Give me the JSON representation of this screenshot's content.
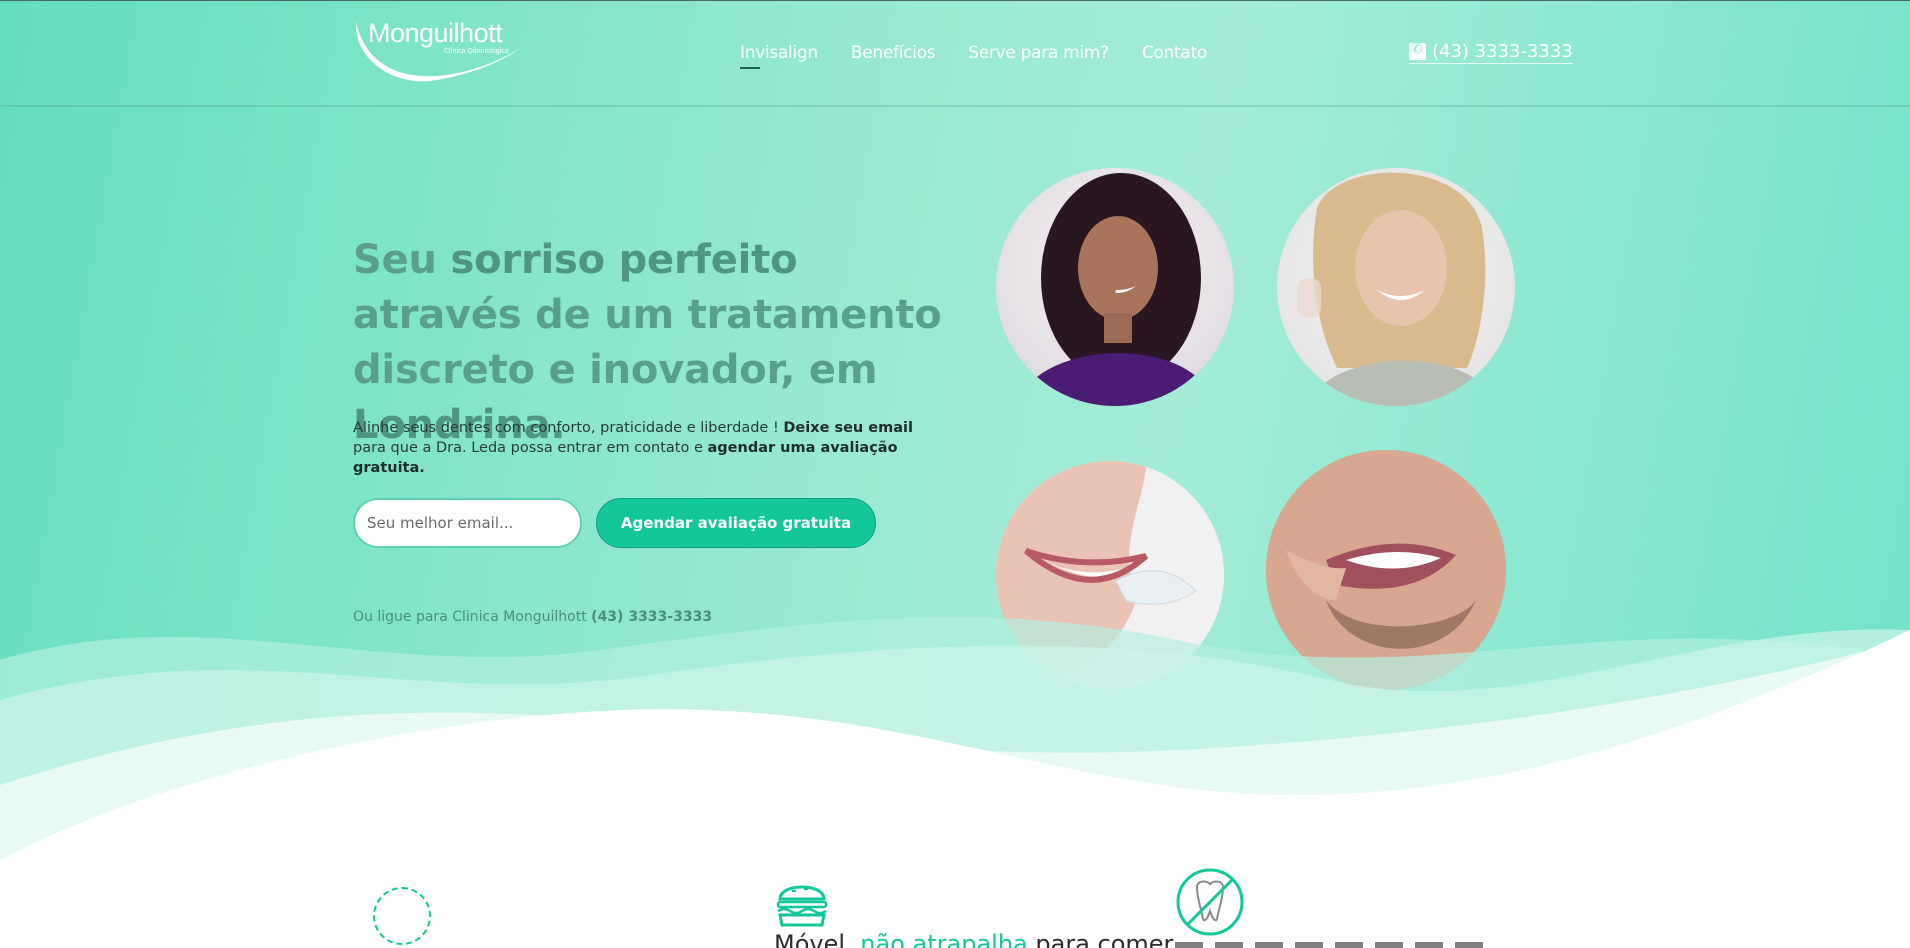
{
  "brand": {
    "name": "Monguilhott",
    "subtitle": "Clínica Odontológica"
  },
  "nav": {
    "items": [
      {
        "label": "Invisalign",
        "active": true
      },
      {
        "label": "Benefícios"
      },
      {
        "label": "Serve para mim?"
      },
      {
        "label": "Contato"
      }
    ]
  },
  "header": {
    "phone": "(43) 3333-3333",
    "phone_icon": "phone-icon"
  },
  "hero": {
    "headline_1": "Seu ",
    "headline_2": "sorriso perfeito",
    "headline_3": " através de um tratamento discreto e inovador, em ",
    "headline_4": "Londrina.",
    "sub_1": "Alinhe seus dentes com conforto, praticidade e liberdade ! ",
    "sub_2": "Deixe seu email",
    "sub_3": " para que a Dra. Leda possa entrar em contato e ",
    "sub_4": "agendar uma avaliação gratuita.",
    "email_placeholder": "Seu melhor email...",
    "cta_label": "Agendar avaliação gratuita",
    "callus_text": "Ou ligue para Clinica Monguilhott ",
    "callus_phone": "(43) 3333-3333"
  },
  "features": {
    "item2_text_1": "Móvel, ",
    "item2_text_2": "não atrapalha",
    "item2_text_3": " para comer",
    "item1_icon": "dashed-circle-icon",
    "item2_icon": "burger-icon",
    "item3_icon": "no-tooth-icon"
  },
  "colors": {
    "accent": "#13c79a",
    "hero_gradient_start": "#63dfbe",
    "hero_gradient_end": "#70e2c8",
    "headline": "#5a9f8c"
  }
}
